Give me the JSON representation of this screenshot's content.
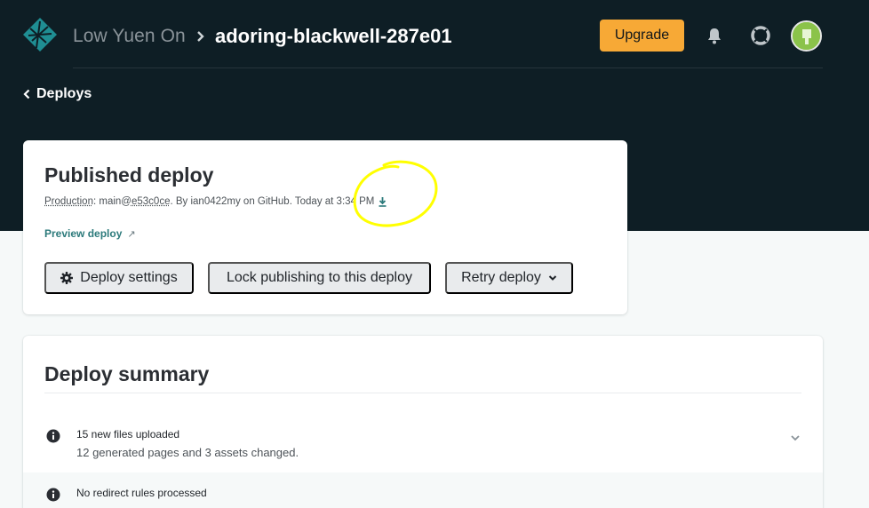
{
  "header": {
    "team_name": "Low Yuen On",
    "site_name": "adoring-blackwell-287e01",
    "upgrade_label": "Upgrade"
  },
  "nav": {
    "back_label": "Deploys"
  },
  "published_deploy": {
    "title": "Published deploy",
    "context_label": "Production",
    "branch_prefix": ": main@",
    "commit": "e53c0ce",
    "by_text": ". By ian0422my on GitHub. Today at 3:34 PM",
    "preview_label": "Preview deploy",
    "preview_arrow": "↗",
    "buttons": {
      "settings": "Deploy settings",
      "lock": "Lock publishing to this deploy",
      "retry": "Retry deploy"
    }
  },
  "deploy_summary": {
    "title": "Deploy summary",
    "items": [
      {
        "title": "15 new files uploaded",
        "description": "12 generated pages and 3 assets changed."
      },
      {
        "title": "No redirect rules processed",
        "description": ""
      }
    ]
  },
  "colors": {
    "header_bg": "#0e1e25",
    "accent_upgrade": "#f7a936",
    "link_teal": "#2c7a7b",
    "annotation": "#ffff00"
  }
}
